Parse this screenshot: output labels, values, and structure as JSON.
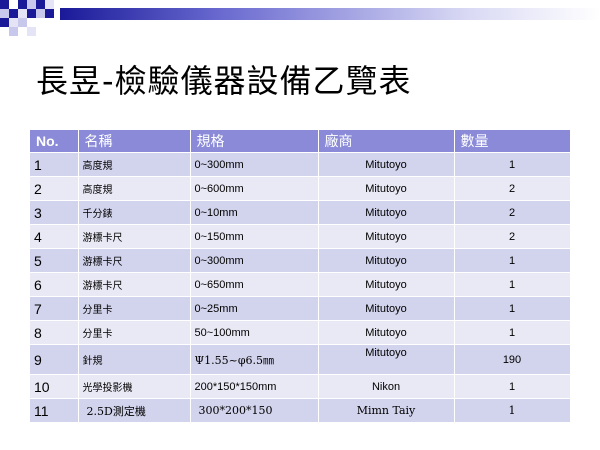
{
  "title": "長昱-檢驗儀器設備乙覽表",
  "colors": {
    "accent": "#1a1a99",
    "header_bg": "#8a8ad8",
    "row_odd": "#d2d3ec",
    "row_even": "#e9e9f5"
  },
  "table": {
    "headers": [
      "No.",
      "名稱",
      "規格",
      "廠商",
      "數量"
    ],
    "rows": [
      [
        "1",
        "高度規",
        "0~300mm",
        "Mitutoyo",
        "1"
      ],
      [
        "2",
        "高度規",
        "0~600mm",
        "Mitutoyo",
        "2"
      ],
      [
        "3",
        "千分錶",
        "0~10mm",
        "Mitutoyo",
        "2"
      ],
      [
        "4",
        "游標卡尺",
        "0~150mm",
        "Mitutoyo",
        "2"
      ],
      [
        "5",
        "游標卡尺",
        "0~300mm",
        "Mitutoyo",
        "1"
      ],
      [
        "6",
        "游標卡尺",
        "0~650mm",
        "Mitutoyo",
        "1"
      ],
      [
        "7",
        "分里卡",
        "0~25mm",
        "Mitutoyo",
        "1"
      ],
      [
        "8",
        "分里卡",
        "50~100mm",
        "Mitutoyo",
        "1"
      ],
      [
        "9",
        "針規",
        "Ψ1.55~φ6.5㎜",
        "Mitutoyo",
        "190"
      ],
      [
        "10",
        "光學投影機",
        "200*150*150mm",
        "Nikon",
        "1"
      ],
      [
        "11",
        "2.5D測定機",
        "300*200*150",
        "Mimn Taiy",
        "1"
      ]
    ]
  }
}
